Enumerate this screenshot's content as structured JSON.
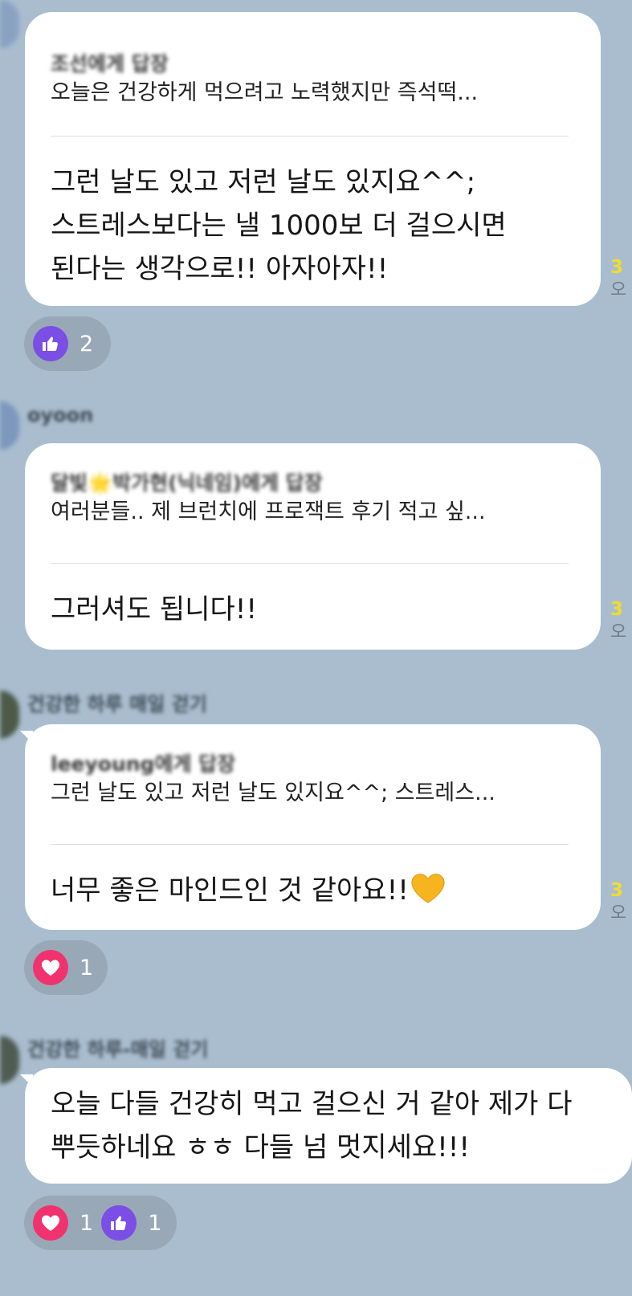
{
  "messages": [
    {
      "reply_to": "조선에게 답장",
      "reply_preview": "오늘은 건강하게 먹으려고 노력했지만 즉석떡...",
      "body_lines": [
        "그런 날도 있고 저런 날도 있지요^^;",
        "스트레스보다는 낼 1000보 더 걸으시면",
        "된다는 생각으로!!  아자아자!!"
      ],
      "unread_count": "3",
      "time": "오",
      "reactions": [
        {
          "icon": "thumbs-up-icon",
          "count": "2"
        }
      ]
    },
    {
      "sender": "oyoon",
      "reply_to": "달빛🌟박가현(닉네임)에게 답장",
      "reply_preview": "여러분들..  제 브런치에 프로잭트 후기 적고 싶...",
      "body_lines": [
        "그러셔도 됩니다!!"
      ],
      "unread_count": "3",
      "time": "오"
    },
    {
      "sender": "건강한 하루 매일 걷기",
      "reply_to": "leeyoung에게 답장",
      "reply_preview": "그런 날도 있고 저런 날도 있지요^^; 스트레스...",
      "body_lines": [
        "너무 좋은 마인드인 것 같아요!!"
      ],
      "unread_count": "3",
      "time": "오",
      "reactions": [
        {
          "icon": "heart-icon",
          "count": "1"
        }
      ]
    },
    {
      "sender": "건강한 하루-매일 걷기",
      "body_lines": [
        "오늘 다들 건강히 먹고 걸으신 거 같아 제가 다",
        "뿌듯하네요 ㅎㅎ 다들 넘 멋지세요!!!"
      ],
      "reactions": [
        {
          "icon": "heart-icon",
          "count": "1"
        },
        {
          "icon": "thumbs-up-icon",
          "count": "1"
        }
      ]
    }
  ],
  "colors": {
    "background": "#a9bdcf",
    "bubble": "#ffffff",
    "unread": "#f2dc2e",
    "like": "#7b4ee6",
    "heart": "#f0336e",
    "emoji_heart": "#f6b51f"
  }
}
